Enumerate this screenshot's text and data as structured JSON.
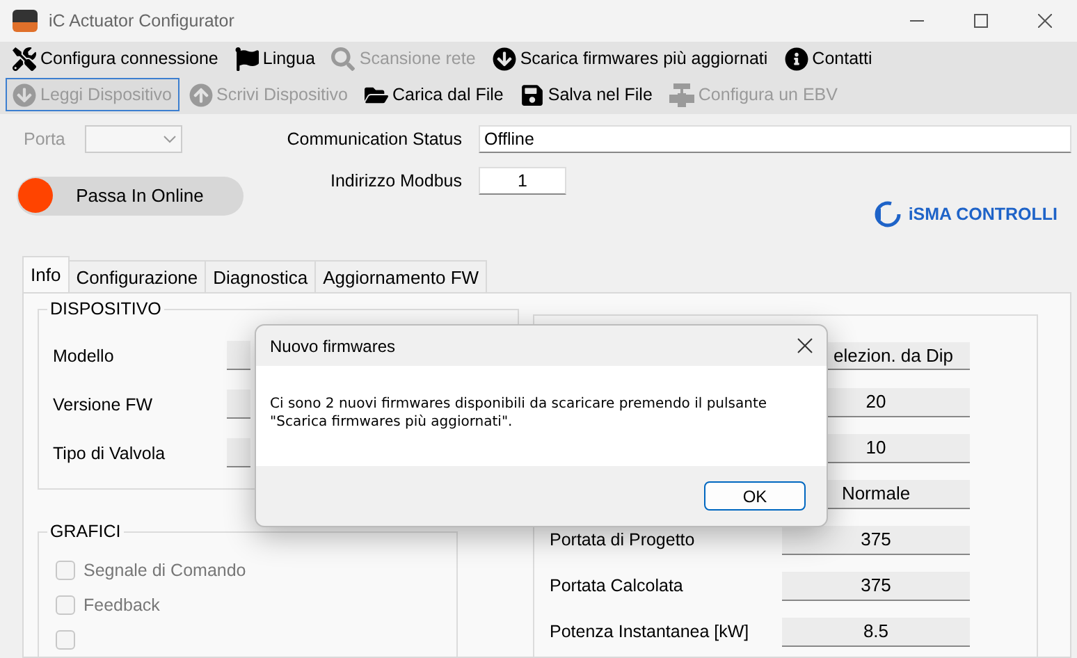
{
  "window": {
    "title": "iC Actuator Configurator"
  },
  "menu_bar": {
    "items": [
      {
        "label": "Configura connessione",
        "disabled": false
      },
      {
        "label": "Lingua",
        "disabled": false
      },
      {
        "label": "Scansione rete",
        "disabled": true
      },
      {
        "label": "Scarica firmwares più aggiornati",
        "disabled": false
      },
      {
        "label": "Contatti",
        "disabled": false
      }
    ]
  },
  "tool_bar": {
    "items": [
      {
        "label": "Leggi Dispositivo",
        "disabled": true,
        "focused": true
      },
      {
        "label": "Scrivi Dispositivo",
        "disabled": true,
        "focused": false
      },
      {
        "label": "Carica dal File",
        "disabled": false,
        "focused": false
      },
      {
        "label": "Salva nel File",
        "disabled": false,
        "focused": false
      },
      {
        "label": "Configura un EBV",
        "disabled": true,
        "focused": false
      }
    ]
  },
  "port": {
    "label": "Porta",
    "disabled": true
  },
  "online_button": {
    "label": "Passa In Online",
    "on": false
  },
  "communication_status": {
    "label": "Communication Status",
    "value": "Offline"
  },
  "modbus_address": {
    "label": "Indirizzo Modbus",
    "value": "1"
  },
  "logo": {
    "text": "iSMA CONTROLLI"
  },
  "tabs": [
    {
      "label": "Info",
      "selected": true
    },
    {
      "label": "Configurazione",
      "selected": false
    },
    {
      "label": "Diagnostica",
      "selected": false
    },
    {
      "label": "Aggiornamento FW",
      "selected": false
    }
  ],
  "device_group": {
    "title": "DISPOSITIVO",
    "fields": [
      {
        "label": "Modello"
      },
      {
        "label": "Versione FW"
      },
      {
        "label": "Tipo di Valvola"
      }
    ]
  },
  "charts_group": {
    "title": "GRAFICI",
    "options": [
      {
        "label": "Segnale di Comando",
        "checked": false,
        "disabled": true
      },
      {
        "label": "Feedback",
        "checked": false,
        "disabled": true
      },
      {
        "checked": false,
        "disabled": true
      }
    ]
  },
  "details": [
    {
      "value": "elezion. da Dip"
    },
    {
      "value": "20"
    },
    {
      "value": "10"
    },
    {
      "value": "Normale"
    },
    {
      "label": "Portata di Progetto",
      "value": "375"
    },
    {
      "label": "Portata Calcolata",
      "value": "375"
    },
    {
      "label": "Potenza Instantanea [kW]",
      "value": "8.5"
    }
  ],
  "dialog": {
    "title": "Nuovo firmwares",
    "message": "Ci sono 2 nuovi firmwares disponibili da scaricare premendo il pulsante \"Scarica firmwares più aggiornati\".",
    "button": "OK"
  }
}
